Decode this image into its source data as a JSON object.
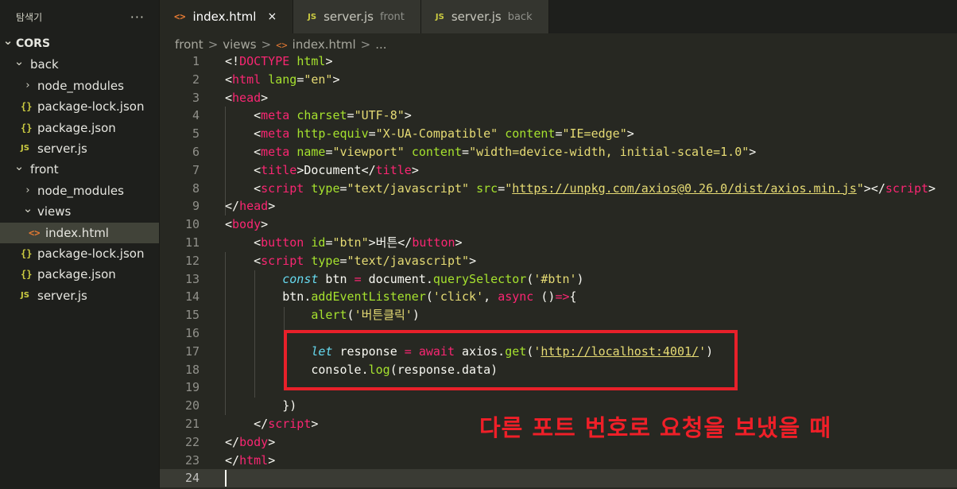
{
  "sidebar": {
    "title": "탐색기",
    "more": "···",
    "tree": [
      {
        "label": "CORS",
        "type": "root"
      },
      {
        "label": "back",
        "type": "folder"
      },
      {
        "label": "node_modules",
        "type": "folder-collapsed"
      },
      {
        "label": "package-lock.json",
        "type": "json",
        "icon": "{}"
      },
      {
        "label": "package.json",
        "type": "json",
        "icon": "{}"
      },
      {
        "label": "server.js",
        "type": "js",
        "icon": "JS"
      },
      {
        "label": "front",
        "type": "folder"
      },
      {
        "label": "node_modules",
        "type": "folder-collapsed"
      },
      {
        "label": "views",
        "type": "folder"
      },
      {
        "label": "index.html",
        "type": "html",
        "icon": "<>",
        "active": true
      },
      {
        "label": "package-lock.json",
        "type": "json",
        "icon": "{}"
      },
      {
        "label": "package.json",
        "type": "json",
        "icon": "{}"
      },
      {
        "label": "server.js",
        "type": "js",
        "icon": "JS"
      }
    ]
  },
  "tabs": [
    {
      "label": "index.html",
      "icon": "<>",
      "active": true,
      "close": "×"
    },
    {
      "label": "server.js",
      "icon": "JS",
      "description": "front"
    },
    {
      "label": "server.js",
      "icon": "JS",
      "description": "back"
    }
  ],
  "breadcrumb": {
    "parts": [
      "front",
      "views",
      "index.html",
      "..."
    ],
    "separator": ">",
    "file_icon": "<>"
  },
  "editor": {
    "lines": [
      {
        "n": "1",
        "tokens": [
          [
            "p",
            "<!"
          ],
          [
            "tag",
            "DOCTYPE"
          ],
          [
            "p",
            " "
          ],
          [
            "attr",
            "html"
          ],
          [
            "p",
            ">"
          ]
        ]
      },
      {
        "n": "2",
        "tokens": [
          [
            "p",
            "<"
          ],
          [
            "tag",
            "html"
          ],
          [
            "p",
            " "
          ],
          [
            "attr",
            "lang"
          ],
          [
            "p",
            "="
          ],
          [
            "str",
            "\"en\""
          ],
          [
            "p",
            ">"
          ]
        ]
      },
      {
        "n": "3",
        "tokens": [
          [
            "p",
            "<"
          ],
          [
            "tag",
            "head"
          ],
          [
            "p",
            ">"
          ]
        ]
      },
      {
        "n": "4",
        "tokens": [
          [
            "p",
            "    <"
          ],
          [
            "tag",
            "meta"
          ],
          [
            "p",
            " "
          ],
          [
            "attr",
            "charset"
          ],
          [
            "p",
            "="
          ],
          [
            "str",
            "\"UTF-8\""
          ],
          [
            "p",
            ">"
          ]
        ]
      },
      {
        "n": "5",
        "tokens": [
          [
            "p",
            "    <"
          ],
          [
            "tag",
            "meta"
          ],
          [
            "p",
            " "
          ],
          [
            "attr",
            "http-equiv"
          ],
          [
            "p",
            "="
          ],
          [
            "str",
            "\"X-UA-Compatible\""
          ],
          [
            "p",
            " "
          ],
          [
            "attr",
            "content"
          ],
          [
            "p",
            "="
          ],
          [
            "str",
            "\"IE=edge\""
          ],
          [
            "p",
            ">"
          ]
        ]
      },
      {
        "n": "6",
        "tokens": [
          [
            "p",
            "    <"
          ],
          [
            "tag",
            "meta"
          ],
          [
            "p",
            " "
          ],
          [
            "attr",
            "name"
          ],
          [
            "p",
            "="
          ],
          [
            "str",
            "\"viewport\""
          ],
          [
            "p",
            " "
          ],
          [
            "attr",
            "content"
          ],
          [
            "p",
            "="
          ],
          [
            "str",
            "\"width=device-width, initial-scale=1.0\""
          ],
          [
            "p",
            ">"
          ]
        ]
      },
      {
        "n": "7",
        "tokens": [
          [
            "p",
            "    <"
          ],
          [
            "tag",
            "title"
          ],
          [
            "p",
            ">Document</"
          ],
          [
            "tag",
            "title"
          ],
          [
            "p",
            ">"
          ]
        ]
      },
      {
        "n": "8",
        "tokens": [
          [
            "p",
            "    <"
          ],
          [
            "tag",
            "script"
          ],
          [
            "p",
            " "
          ],
          [
            "attr",
            "type"
          ],
          [
            "p",
            "="
          ],
          [
            "str",
            "\"text/javascript\""
          ],
          [
            "p",
            " "
          ],
          [
            "attr",
            "src"
          ],
          [
            "p",
            "="
          ],
          [
            "str",
            "\""
          ],
          [
            "link",
            "https://unpkg.com/axios@0.26.0/dist/axios.min.js"
          ],
          [
            "str",
            "\""
          ],
          [
            "p",
            "></"
          ],
          [
            "tag",
            "script"
          ],
          [
            "p",
            ">"
          ]
        ]
      },
      {
        "n": "9",
        "tokens": [
          [
            "p",
            "</"
          ],
          [
            "tag",
            "head"
          ],
          [
            "p",
            ">"
          ]
        ]
      },
      {
        "n": "10",
        "tokens": [
          [
            "p",
            "<"
          ],
          [
            "tag",
            "body"
          ],
          [
            "p",
            ">"
          ]
        ]
      },
      {
        "n": "11",
        "tokens": [
          [
            "p",
            "    <"
          ],
          [
            "tag",
            "button"
          ],
          [
            "p",
            " "
          ],
          [
            "attr",
            "id"
          ],
          [
            "p",
            "="
          ],
          [
            "str",
            "\"btn\""
          ],
          [
            "p",
            ">버튼</"
          ],
          [
            "tag",
            "button"
          ],
          [
            "p",
            ">"
          ]
        ]
      },
      {
        "n": "12",
        "tokens": [
          [
            "p",
            "    <"
          ],
          [
            "tag",
            "script"
          ],
          [
            "p",
            " "
          ],
          [
            "attr",
            "type"
          ],
          [
            "p",
            "="
          ],
          [
            "str",
            "\"text/javascript\""
          ],
          [
            "p",
            ">"
          ]
        ]
      },
      {
        "n": "13",
        "tokens": [
          [
            "p",
            "        "
          ],
          [
            "kw",
            "const"
          ],
          [
            "p",
            " btn "
          ],
          [
            "op",
            "="
          ],
          [
            "p",
            " document."
          ],
          [
            "fn",
            "querySelector"
          ],
          [
            "p",
            "("
          ],
          [
            "str",
            "'#btn'"
          ],
          [
            "p",
            ")"
          ]
        ]
      },
      {
        "n": "14",
        "tokens": [
          [
            "p",
            "        btn."
          ],
          [
            "fn",
            "addEventListener"
          ],
          [
            "p",
            "("
          ],
          [
            "str",
            "'click'"
          ],
          [
            "p",
            ", "
          ],
          [
            "kw2",
            "async"
          ],
          [
            "p",
            " ()"
          ],
          [
            "op",
            "=>"
          ],
          [
            "p",
            "{"
          ]
        ]
      },
      {
        "n": "15",
        "tokens": [
          [
            "p",
            "            "
          ],
          [
            "fn",
            "alert"
          ],
          [
            "p",
            "("
          ],
          [
            "str",
            "'버튼클릭'"
          ],
          [
            "p",
            ")"
          ]
        ]
      },
      {
        "n": "16",
        "tokens": []
      },
      {
        "n": "17",
        "tokens": [
          [
            "p",
            "            "
          ],
          [
            "kw",
            "let"
          ],
          [
            "p",
            " response "
          ],
          [
            "op",
            "="
          ],
          [
            "p",
            " "
          ],
          [
            "op",
            "await"
          ],
          [
            "p",
            " axios."
          ],
          [
            "fn",
            "get"
          ],
          [
            "p",
            "("
          ],
          [
            "str",
            "'"
          ],
          [
            "link",
            "http://localhost:4001/"
          ],
          [
            "str",
            "'"
          ],
          [
            "p",
            ")"
          ]
        ]
      },
      {
        "n": "18",
        "tokens": [
          [
            "p",
            "            console."
          ],
          [
            "fn",
            "log"
          ],
          [
            "p",
            "(response.data)"
          ]
        ]
      },
      {
        "n": "19",
        "tokens": []
      },
      {
        "n": "20",
        "tokens": [
          [
            "p",
            "        })"
          ]
        ]
      },
      {
        "n": "21",
        "tokens": [
          [
            "p",
            "    </"
          ],
          [
            "tag",
            "script"
          ],
          [
            "p",
            ">"
          ]
        ]
      },
      {
        "n": "22",
        "tokens": [
          [
            "p",
            "</"
          ],
          [
            "tag",
            "body"
          ],
          [
            "p",
            ">"
          ]
        ]
      },
      {
        "n": "23",
        "tokens": [
          [
            "p",
            "</"
          ],
          [
            "tag",
            "html"
          ],
          [
            "p",
            ">"
          ]
        ]
      },
      {
        "n": "24",
        "tokens": [],
        "current": true
      }
    ]
  },
  "annotation": {
    "text": "다른 포트 번호로 요청을 보냈을 때",
    "color": "#ef1f28"
  },
  "colors": {
    "tag": "#f92672",
    "attribute": "#a6e22e",
    "string": "#e6db74",
    "keyword": "#66d9ef",
    "background": "#272822",
    "sidebar_background": "#1e1f1c",
    "highlight_box": "#e8202a"
  }
}
